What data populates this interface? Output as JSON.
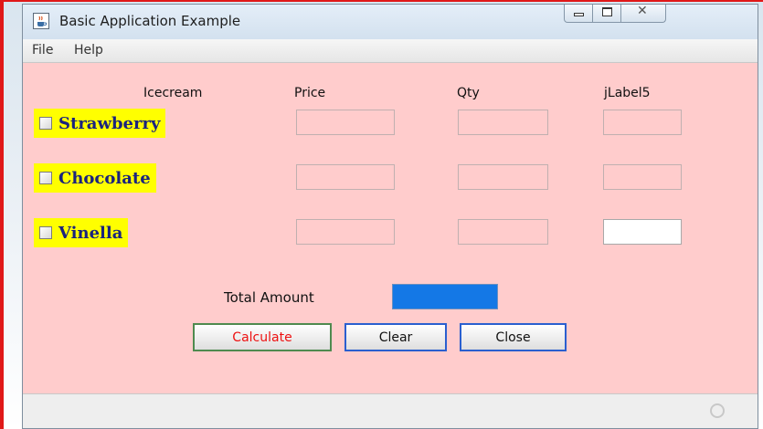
{
  "window": {
    "title": "Basic Application Example",
    "icon": "java-cup-icon"
  },
  "menu": {
    "file": "File",
    "help": "Help"
  },
  "columns": {
    "icecream": "Icecream",
    "price": "Price",
    "qty": "Qty",
    "label5": "jLabel5"
  },
  "flavors": [
    {
      "name": "Strawberry",
      "checked": false
    },
    {
      "name": "Chocolate",
      "checked": false
    },
    {
      "name": "Vinella",
      "checked": false
    }
  ],
  "fields": {
    "price": [
      "",
      "",
      ""
    ],
    "qty": [
      "",
      "",
      ""
    ],
    "label5": [
      "",
      "",
      ""
    ]
  },
  "total": {
    "label": "Total Amount",
    "value": ""
  },
  "buttons": {
    "calculate": "Calculate",
    "clear": "Clear",
    "close": "Close"
  },
  "colors": {
    "panel_bg": "#ffcccc",
    "flavor_bg": "#ffff00",
    "flavor_text": "#1a237e",
    "total_field": "#1478e6",
    "calculate_text": "#ee1111",
    "calculate_border": "#4f8a4f",
    "button_border": "#2a5fcf"
  }
}
